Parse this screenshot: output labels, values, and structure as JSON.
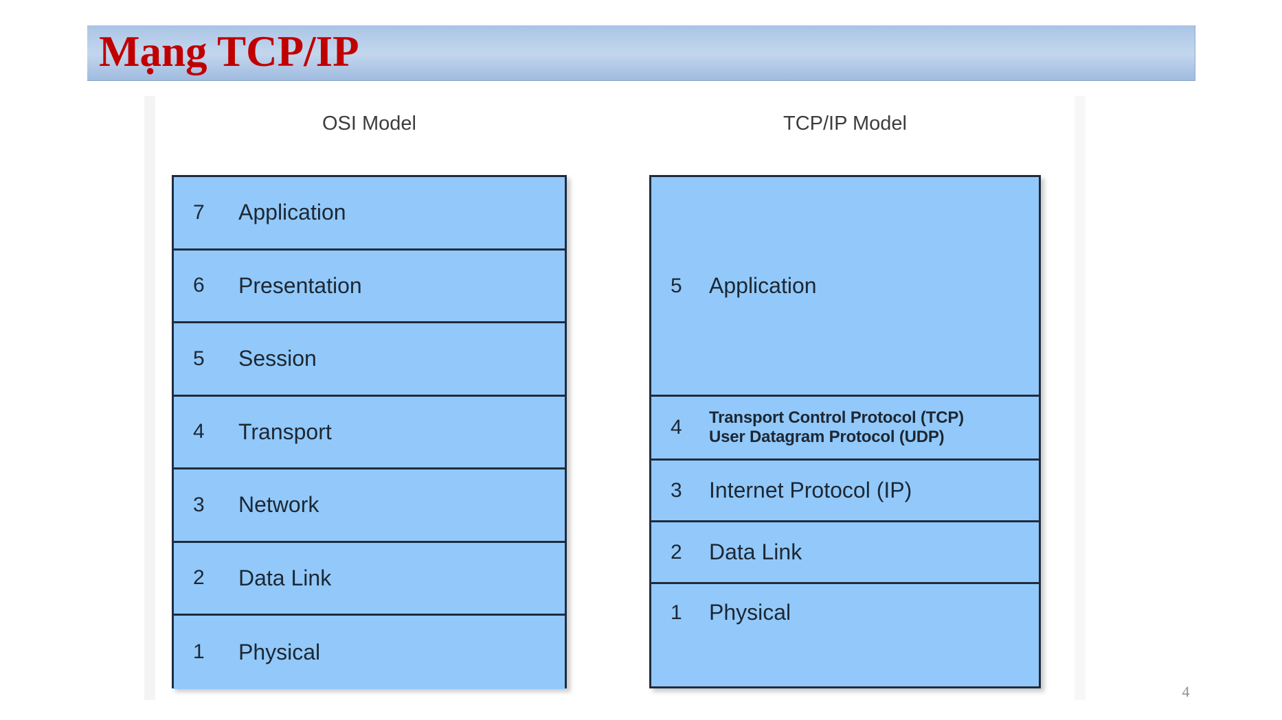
{
  "slide": {
    "title": "Mạng TCP/IP",
    "page_number": "4",
    "title_color": "#C00000",
    "title_bar_color": "#B3CBE8",
    "layer_fill_color": "#92C9FA",
    "layer_border_color": "#1F2B3D"
  },
  "diagram": {
    "type": "table",
    "columns": [
      {
        "id": "osi",
        "header": "OSI Model",
        "layers": [
          {
            "number": "7",
            "label": "Application"
          },
          {
            "number": "6",
            "label": "Presentation"
          },
          {
            "number": "5",
            "label": "Session"
          },
          {
            "number": "4",
            "label": "Transport"
          },
          {
            "number": "3",
            "label": "Network"
          },
          {
            "number": "2",
            "label": "Data Link"
          },
          {
            "number": "1",
            "label": "Physical"
          }
        ]
      },
      {
        "id": "tcpip",
        "header": "TCP/IP Model",
        "layers": [
          {
            "number": "5",
            "label": "Application"
          },
          {
            "number": "4",
            "label": "Transport Control Protocol (TCP)\nUser Datagram Protocol (UDP)"
          },
          {
            "number": "3",
            "label": "Internet Protocol (IP)"
          },
          {
            "number": "2",
            "label": "Data Link"
          },
          {
            "number": "1",
            "label": "Physical"
          }
        ]
      }
    ]
  }
}
